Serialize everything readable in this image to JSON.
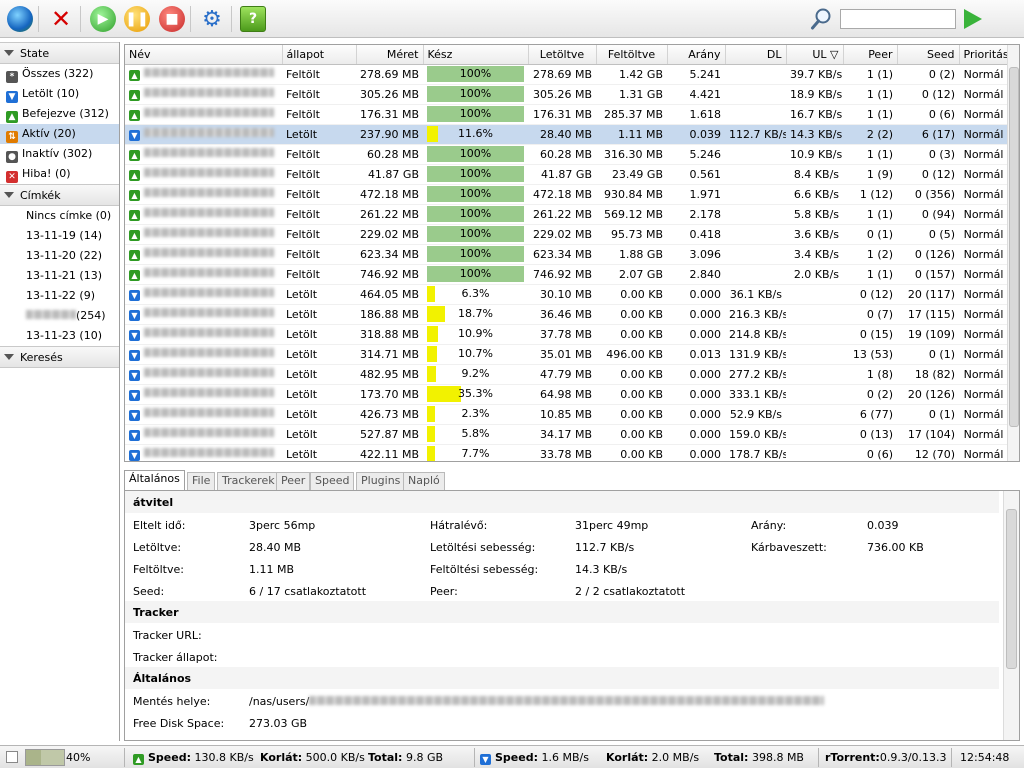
{
  "search": {
    "value": ""
  },
  "sidebar": {
    "state_header": "State",
    "state_items": [
      {
        "label": "Összes (322)",
        "icon": "asterisk-icon",
        "selected": false
      },
      {
        "label": "Letölt (10)",
        "icon": "download-icon",
        "selected": false
      },
      {
        "label": "Befejezve (312)",
        "icon": "upload-icon",
        "selected": false
      },
      {
        "label": "Aktív (20)",
        "icon": "active-icon",
        "selected": true
      },
      {
        "label": "Inaktív (302)",
        "icon": "inactive-icon",
        "selected": false
      },
      {
        "label": "Hiba! (0)",
        "icon": "error-icon",
        "selected": false
      }
    ],
    "labels_header": "Címkék",
    "label_items": [
      "Nincs címke (0)",
      "13-11-19 (14)",
      "13-11-20 (22)",
      "13-11-21 (13)",
      "13-11-22 (9)",
      "(254)",
      "13-11-23 (10)"
    ],
    "search_header": "Keresés"
  },
  "table": {
    "columns": [
      "Név",
      "állapot",
      "Méret",
      "Kész",
      "Letöltve",
      "Feltöltve",
      "Arány",
      "DL",
      "UL",
      "Peer",
      "Seed",
      "Prioritás"
    ],
    "rows": [
      {
        "dir": "up",
        "status": "Feltölt",
        "size": "278.69 MB",
        "done": 100,
        "done_text": "100%",
        "down": "278.69 MB",
        "up": "1.42 GB",
        "ratio": "5.241",
        "dl": "",
        "ul": "39.7 KB/s",
        "peer": "1 (1)",
        "seed": "0 (2)",
        "prio": "Normál"
      },
      {
        "dir": "up",
        "status": "Feltölt",
        "size": "305.26 MB",
        "done": 100,
        "done_text": "100%",
        "down": "305.26 MB",
        "up": "1.31 GB",
        "ratio": "4.421",
        "dl": "",
        "ul": "18.9 KB/s",
        "peer": "1 (1)",
        "seed": "0 (12)",
        "prio": "Normál"
      },
      {
        "dir": "up",
        "status": "Feltölt",
        "size": "176.31 MB",
        "done": 100,
        "done_text": "100%",
        "down": "176.31 MB",
        "up": "285.37 MB",
        "ratio": "1.618",
        "dl": "",
        "ul": "16.7 KB/s",
        "peer": "1 (1)",
        "seed": "0 (6)",
        "prio": "Normál"
      },
      {
        "dir": "down",
        "status": "Letölt",
        "size": "237.90 MB",
        "done": 11.6,
        "done_text": "11.6%",
        "down": "28.40 MB",
        "up": "1.11 MB",
        "ratio": "0.039",
        "dl": "112.7 KB/s",
        "ul": "14.3 KB/s",
        "peer": "2 (2)",
        "seed": "6 (17)",
        "prio": "Normál",
        "selected": true
      },
      {
        "dir": "up",
        "status": "Feltölt",
        "size": "60.28 MB",
        "done": 100,
        "done_text": "100%",
        "down": "60.28 MB",
        "up": "316.30 MB",
        "ratio": "5.246",
        "dl": "",
        "ul": "10.9 KB/s",
        "peer": "1 (1)",
        "seed": "0 (3)",
        "prio": "Normál"
      },
      {
        "dir": "up",
        "status": "Feltölt",
        "size": "41.87 GB",
        "done": 100,
        "done_text": "100%",
        "down": "41.87 GB",
        "up": "23.49 GB",
        "ratio": "0.561",
        "dl": "",
        "ul": "8.4 KB/s",
        "peer": "1 (9)",
        "seed": "0 (12)",
        "prio": "Normál"
      },
      {
        "dir": "up",
        "status": "Feltölt",
        "size": "472.18 MB",
        "done": 100,
        "done_text": "100%",
        "down": "472.18 MB",
        "up": "930.84 MB",
        "ratio": "1.971",
        "dl": "",
        "ul": "6.6 KB/s",
        "peer": "1 (12)",
        "seed": "0 (356)",
        "prio": "Normál"
      },
      {
        "dir": "up",
        "status": "Feltölt",
        "size": "261.22 MB",
        "done": 100,
        "done_text": "100%",
        "down": "261.22 MB",
        "up": "569.12 MB",
        "ratio": "2.178",
        "dl": "",
        "ul": "5.8 KB/s",
        "peer": "1 (1)",
        "seed": "0 (94)",
        "prio": "Normál"
      },
      {
        "dir": "up",
        "status": "Feltölt",
        "size": "229.02 MB",
        "done": 100,
        "done_text": "100%",
        "down": "229.02 MB",
        "up": "95.73 MB",
        "ratio": "0.418",
        "dl": "",
        "ul": "3.6 KB/s",
        "peer": "0 (1)",
        "seed": "0 (5)",
        "prio": "Normál"
      },
      {
        "dir": "up",
        "status": "Feltölt",
        "size": "623.34 MB",
        "done": 100,
        "done_text": "100%",
        "down": "623.34 MB",
        "up": "1.88 GB",
        "ratio": "3.096",
        "dl": "",
        "ul": "3.4 KB/s",
        "peer": "1 (2)",
        "seed": "0 (126)",
        "prio": "Normál"
      },
      {
        "dir": "up",
        "status": "Feltölt",
        "size": "746.92 MB",
        "done": 100,
        "done_text": "100%",
        "down": "746.92 MB",
        "up": "2.07 GB",
        "ratio": "2.840",
        "dl": "",
        "ul": "2.0 KB/s",
        "peer": "1 (1)",
        "seed": "0 (157)",
        "prio": "Normál"
      },
      {
        "dir": "down",
        "status": "Letölt",
        "size": "464.05 MB",
        "done": 6.3,
        "done_text": "6.3%",
        "down": "30.10 MB",
        "up": "0.00 KB",
        "ratio": "0.000",
        "dl": "36.1 KB/s",
        "ul": "",
        "peer": "0 (12)",
        "seed": "20 (117)",
        "prio": "Normál"
      },
      {
        "dir": "down",
        "status": "Letölt",
        "size": "186.88 MB",
        "done": 18.7,
        "done_text": "18.7%",
        "down": "36.46 MB",
        "up": "0.00 KB",
        "ratio": "0.000",
        "dl": "216.3 KB/s",
        "ul": "",
        "peer": "0 (7)",
        "seed": "17 (115)",
        "prio": "Normál"
      },
      {
        "dir": "down",
        "status": "Letölt",
        "size": "318.88 MB",
        "done": 10.9,
        "done_text": "10.9%",
        "down": "37.78 MB",
        "up": "0.00 KB",
        "ratio": "0.000",
        "dl": "214.8 KB/s",
        "ul": "",
        "peer": "0 (15)",
        "seed": "19 (109)",
        "prio": "Normál"
      },
      {
        "dir": "down",
        "status": "Letölt",
        "size": "314.71 MB",
        "done": 10.7,
        "done_text": "10.7%",
        "down": "35.01 MB",
        "up": "496.00 KB",
        "ratio": "0.013",
        "dl": "131.9 KB/s",
        "ul": "",
        "peer": "13 (53)",
        "seed": "0 (1)",
        "prio": "Normál"
      },
      {
        "dir": "down",
        "status": "Letölt",
        "size": "482.95 MB",
        "done": 9.2,
        "done_text": "9.2%",
        "down": "47.79 MB",
        "up": "0.00 KB",
        "ratio": "0.000",
        "dl": "277.2 KB/s",
        "ul": "",
        "peer": "1 (8)",
        "seed": "18 (82)",
        "prio": "Normál"
      },
      {
        "dir": "down",
        "status": "Letölt",
        "size": "173.70 MB",
        "done": 35.3,
        "done_text": "35.3%",
        "down": "64.98 MB",
        "up": "0.00 KB",
        "ratio": "0.000",
        "dl": "333.1 KB/s",
        "ul": "",
        "peer": "0 (2)",
        "seed": "20 (126)",
        "prio": "Normál"
      },
      {
        "dir": "down",
        "status": "Letölt",
        "size": "426.73 MB",
        "done": 2.3,
        "done_text": "2.3%",
        "down": "10.85 MB",
        "up": "0.00 KB",
        "ratio": "0.000",
        "dl": "52.9 KB/s",
        "ul": "",
        "peer": "6 (77)",
        "seed": "0 (1)",
        "prio": "Normál"
      },
      {
        "dir": "down",
        "status": "Letölt",
        "size": "527.87 MB",
        "done": 5.8,
        "done_text": "5.8%",
        "down": "34.17 MB",
        "up": "0.00 KB",
        "ratio": "0.000",
        "dl": "159.0 KB/s",
        "ul": "",
        "peer": "0 (13)",
        "seed": "17 (104)",
        "prio": "Normál"
      },
      {
        "dir": "down",
        "status": "Letölt",
        "size": "422.11 MB",
        "done": 7.7,
        "done_text": "7.7%",
        "down": "33.78 MB",
        "up": "0.00 KB",
        "ratio": "0.000",
        "dl": "178.7 KB/s",
        "ul": "",
        "peer": "0 (6)",
        "seed": "12 (70)",
        "prio": "Normál"
      }
    ]
  },
  "tabs": [
    "Általános",
    "File",
    "Trackerek",
    "Peer",
    "Speed",
    "Plugins",
    "Napló"
  ],
  "details": {
    "transfer_title": "átvitel",
    "elapsed_label": "Eltelt idő:",
    "elapsed_value": "3perc 56mp",
    "remaining_label": "Hátralévő:",
    "remaining_value": "31perc 49mp",
    "ratio_label": "Arány:",
    "ratio_value": "0.039",
    "downloaded_label": "Letöltve:",
    "downloaded_value": "28.40 MB",
    "dl_speed_label": "Letöltési sebesség:",
    "dl_speed_value": "112.7 KB/s",
    "wasted_label": "Kárbaveszett:",
    "wasted_value": "736.00 KB",
    "uploaded_label": "Feltöltve:",
    "uploaded_value": "1.11 MB",
    "ul_speed_label": "Feltöltési sebesség:",
    "ul_speed_value": "14.3 KB/s",
    "seed_label": "Seed:",
    "seed_value": "6 / 17 csatlakoztatott",
    "peer_label": "Peer:",
    "peer_value": "2 / 2 csatlakoztatott",
    "tracker_title": "Tracker",
    "tracker_url_label": "Tracker URL:",
    "tracker_state_label": "Tracker állapot:",
    "general_title": "Általános",
    "save_path_label": "Mentés helye:",
    "save_path_value": "/nas/users/",
    "free_disk_label": "Free Disk Space:",
    "free_disk_value": "273.03 GB"
  },
  "statusbar": {
    "cpu_percent": 40,
    "cpu_text": "40%",
    "up_speed_label": "Speed:",
    "up_speed": "130.8 KB/s",
    "up_limit_label": "Korlát:",
    "up_limit": "500.0 KB/s",
    "up_total_label": "Total:",
    "up_total": "9.8 GB",
    "down_speed_label": "Speed:",
    "down_speed": "1.6 MB/s",
    "down_limit_label": "Korlát:",
    "down_limit": "2.0 MB/s",
    "down_total_label": "Total:",
    "down_total": "398.8 MB",
    "client_label": "rTorrent:",
    "client_version": "0.9.3/0.13.3",
    "clock": "12:54:48"
  },
  "colors": {
    "complete_bar": "#9acb8c",
    "progress_bar": "#f2f200",
    "selection": "#c7d9ee"
  }
}
